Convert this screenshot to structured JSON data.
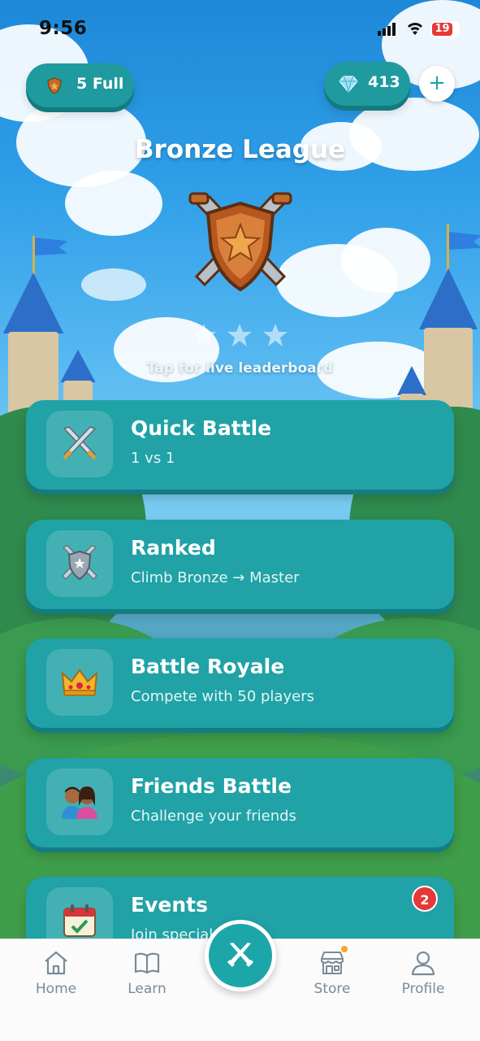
{
  "status_bar": {
    "time": "9:56",
    "battery": "19"
  },
  "header": {
    "league_badge": "5 Full",
    "gems": "413",
    "add_icon": "plus-icon"
  },
  "league": {
    "title": "Bronze League",
    "stars_filled": 0,
    "stars_total": 3,
    "hint": "Tap for live leaderboard"
  },
  "modes": [
    {
      "title": "Quick Battle",
      "subtitle": "1 vs 1",
      "icon": "crossed-swords-icon"
    },
    {
      "title": "Ranked",
      "subtitle": "Climb Bronze → Master",
      "icon": "shield-swords-icon"
    },
    {
      "title": "Battle Royale",
      "subtitle": "Compete with 50 players",
      "icon": "crown-icon"
    },
    {
      "title": "Friends Battle",
      "subtitle": "Challenge your friends",
      "icon": "friends-icon"
    },
    {
      "title": "Events",
      "subtitle": "Join special events",
      "icon": "calendar-icon",
      "badge": "2"
    }
  ],
  "nav": {
    "items": [
      {
        "label": "Home",
        "icon": "home-icon"
      },
      {
        "label": "Learn",
        "icon": "book-icon"
      },
      {
        "label": "",
        "icon": "battle-swords-icon"
      },
      {
        "label": "Store",
        "icon": "store-icon"
      },
      {
        "label": "Profile",
        "icon": "person-icon"
      }
    ]
  },
  "colors": {
    "accent": "#20a2a6",
    "badge": "#e53935",
    "nav_text": "#7a8b99"
  }
}
